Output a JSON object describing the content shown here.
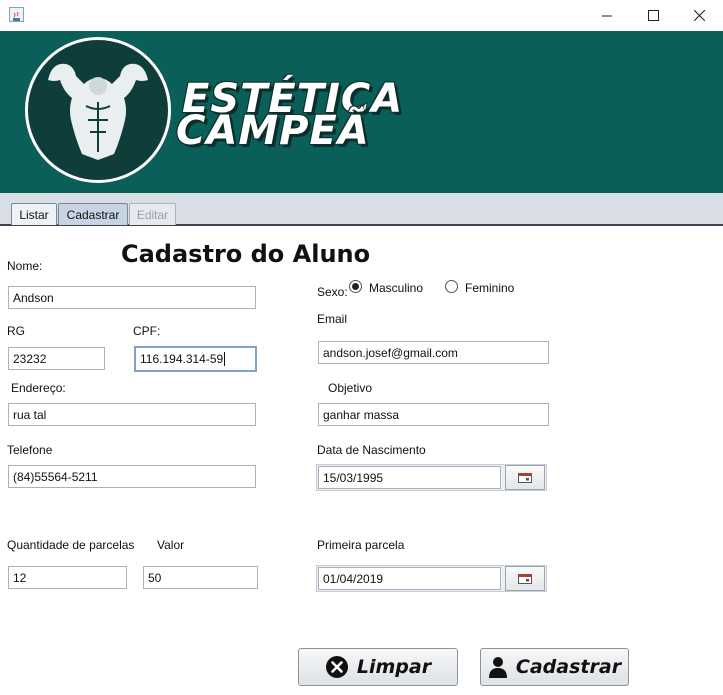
{
  "window": {
    "minimize_symbol": "—",
    "maximize_symbol": "☐",
    "close_symbol": "✕"
  },
  "banner": {
    "brand_line1": "ESTÉTICA",
    "brand_line2": "CAMPEÃ",
    "colors": {
      "background": "#0a5f58",
      "logo_circle": "#0f3d3a"
    }
  },
  "tabs": [
    {
      "label": "Listar",
      "state": "normal"
    },
    {
      "label": "Cadastrar",
      "state": "selected"
    },
    {
      "label": "Editar",
      "state": "disabled"
    }
  ],
  "form": {
    "title": "Cadastro do Aluno",
    "nome": {
      "label": "Nome:",
      "value": "Andson"
    },
    "rg": {
      "label": "RG",
      "value": "23232"
    },
    "cpf": {
      "label": "CPF:",
      "value": "116.194.314-59"
    },
    "endereco": {
      "label": "Endereço:",
      "value": "rua tal"
    },
    "telefone": {
      "label": "Telefone",
      "value": "(84)55564-5211"
    },
    "parcelas": {
      "label": "Quantidade de parcelas",
      "value": "12"
    },
    "valor": {
      "label": "Valor",
      "value": "50"
    },
    "sexo": {
      "label": "Sexo:",
      "options": [
        {
          "label": "Masculino",
          "selected": true
        },
        {
          "label": "Feminino",
          "selected": false
        }
      ]
    },
    "email": {
      "label": "Email",
      "value": "andson.josef@gmail.com"
    },
    "objetivo": {
      "label": "Objetivo",
      "value": "ganhar massa"
    },
    "nascimento": {
      "label": "Data de Nascimento",
      "value": "15/03/1995"
    },
    "primeira_parcela": {
      "label": "Primeira parcela",
      "value": "01/04/2019"
    }
  },
  "buttons": {
    "limpar": {
      "label": "Limpar",
      "icon": "x-circle-icon"
    },
    "cadastrar": {
      "label": "Cadastrar",
      "icon": "user-icon"
    }
  }
}
